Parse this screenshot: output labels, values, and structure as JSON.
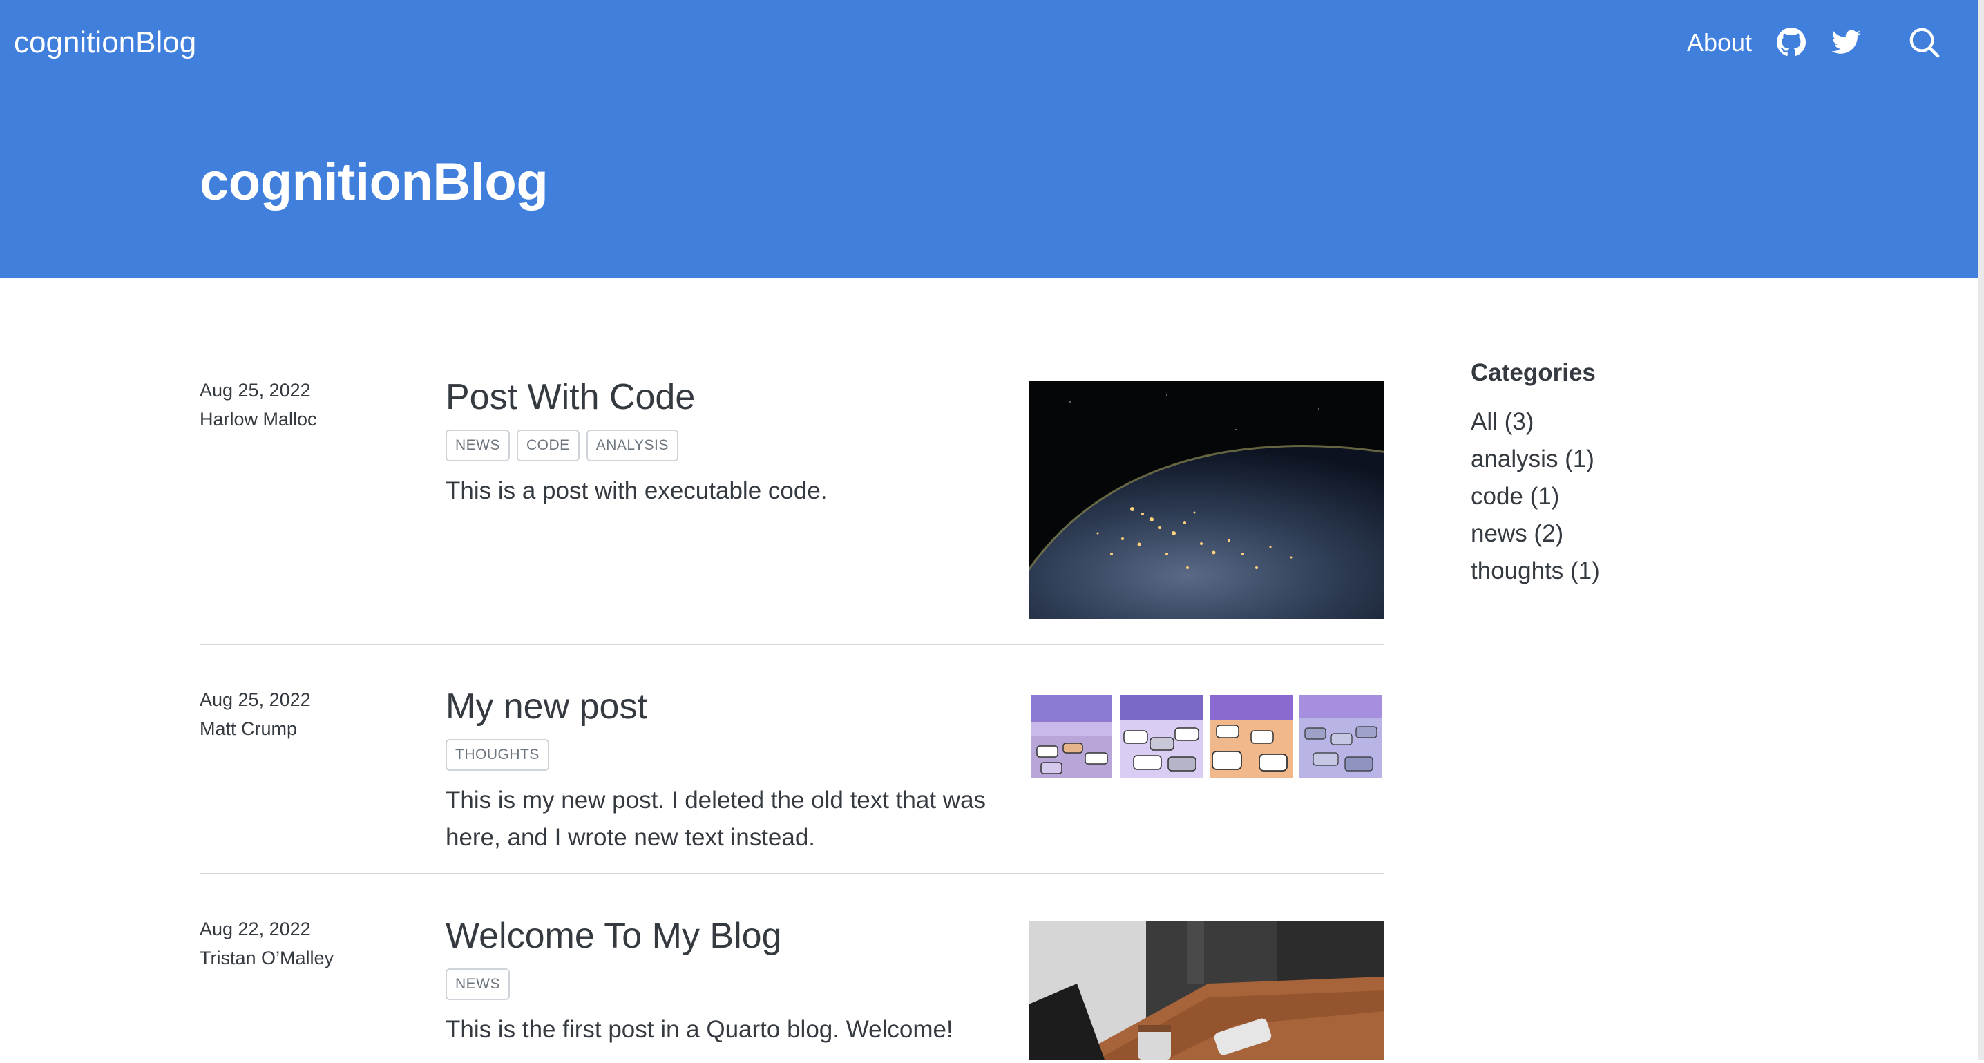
{
  "header": {
    "brand": "cognitionBlog",
    "nav": {
      "about": "About",
      "github_icon": "github-icon",
      "twitter_icon": "twitter-icon",
      "search_icon": "search-icon"
    },
    "title": "cognitionBlog",
    "colors": {
      "background": "#4080dc",
      "text": "#ffffff"
    }
  },
  "posts": [
    {
      "date": "Aug 25, 2022",
      "author": "Harlow Malloc",
      "title": "Post With Code",
      "categories": [
        "NEWS",
        "CODE",
        "ANALYSIS"
      ],
      "description": "This is a post with executable code."
    },
    {
      "date": "Aug 25, 2022",
      "author": "Matt Crump",
      "title": "My new post",
      "categories": [
        "THOUGHTS"
      ],
      "description": "This is my new post. I deleted the old text that was here, and I wrote new text instead."
    },
    {
      "date": "Aug 22, 2022",
      "author": "Tristan O’Malley",
      "title": "Welcome To My Blog",
      "categories": [
        "NEWS"
      ],
      "description": "This is the first post in a Quarto blog. Welcome!"
    }
  ],
  "sidebar": {
    "heading": "Categories",
    "items": [
      {
        "label": "All (3)"
      },
      {
        "label": "analysis (1)"
      },
      {
        "label": "code (1)"
      },
      {
        "label": "news (2)"
      },
      {
        "label": "thoughts (1)"
      }
    ]
  }
}
